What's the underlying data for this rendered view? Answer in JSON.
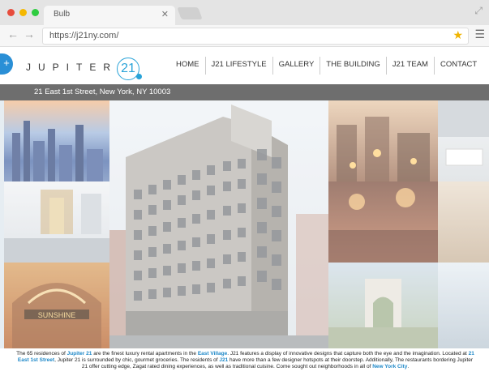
{
  "browser": {
    "tab_title": "Bulb",
    "url": "https://j21ny.com/",
    "colors": {
      "close": "#e74c3c",
      "minimize": "#f5b800",
      "maximize": "#2ecc40"
    }
  },
  "site": {
    "logo_word": "JUPITER",
    "logo_number": "21",
    "plus_label": "+",
    "nav": [
      "HOME",
      "J21 LIFESTYLE",
      "GALLERY",
      "THE BUILDING",
      "J21 TEAM",
      "CONTACT"
    ],
    "address": "21 East 1st Street, New York, NY 10003",
    "caption": {
      "p1": "The 65 residences of",
      "l1": "Jupiter 21",
      "p2": "are the finest luxury rental apartments in the",
      "l2": "East Village",
      "p3": ". J21 features a display of innovative designs that capture both the eye and the imagination. Located at",
      "l3": "21 East 1st Street",
      "p4": ", Jupiter 21 is surrounded by chic, gourmet groceries. The residents of",
      "l4": "J21",
      "p5": "have more than a few designer hotspots at their doorstep. Additionally, The restaurants bordering Jupiter 21 offer cutting edge, Zagat rated dining experiences, as well as traditional cuisine. Come sought out neighborhoods in all of",
      "l5": "New York City",
      "p6": "."
    },
    "accent": "#29a3d8"
  }
}
